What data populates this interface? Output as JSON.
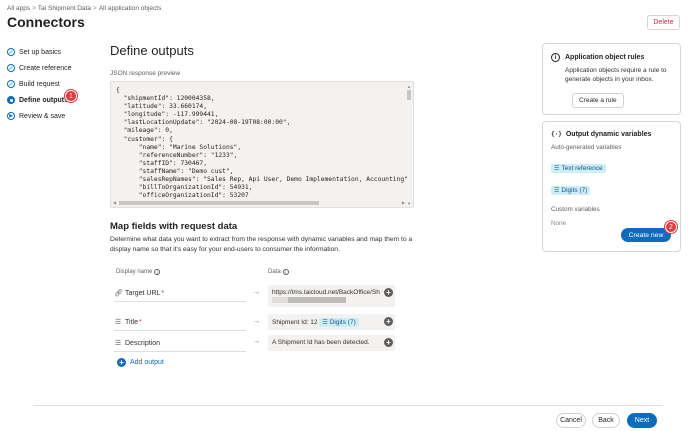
{
  "breadcrumb": [
    "All apps",
    "Tai Shipment Data",
    "All application objects"
  ],
  "page_title": "Connectors",
  "delete_label": "Delete",
  "steps": [
    {
      "label": "Set up basics",
      "state": "done"
    },
    {
      "label": "Create reference",
      "state": "done"
    },
    {
      "label": "Build request",
      "state": "done"
    },
    {
      "label": "Define outputs",
      "state": "current"
    },
    {
      "label": "Review & save",
      "state": "pending"
    }
  ],
  "annotations": {
    "step_badge": "1",
    "create_badge": "2"
  },
  "main": {
    "title": "Define outputs",
    "json_label": "JSON response preview",
    "json_lines": [
      "{",
      "  \"shipmentId\": 120004358,",
      "  \"latitude\": 33.660174,",
      "  \"longitude\": -117.999441,",
      "  \"lastLocationUpdate\": \"2024-08-19T08:00:00\",",
      "  \"mileage\": 0,",
      "  \"customer\": {",
      "      \"name\": \"Marine Solutions\",",
      "      \"referenceNumber\": \"1233\",",
      "      \"staffID\": 730467,",
      "      \"staffName\": \"Demo cust\",",
      "      \"salesRepNames\": \"Sales Rep, Api User, Demo Implementation, Accounting\"",
      "      \"billToOrganizationId\": 54931,",
      "      \"officeOrganizationId\": 53207"
    ],
    "map_title": "Map fields with request data",
    "map_desc": "Determine what data you want to extract from the response with dynamic variables and map them to a display name so that it's easy for your end-users to consumer the information.",
    "col_display": "Display name",
    "col_data": "Data",
    "rows": [
      {
        "name": "Target URL",
        "required": "*",
        "icon": "link-icon",
        "data": "https://tms.taicloud.net/BackOffice/Sh"
      },
      {
        "name": "Title",
        "required": "*",
        "icon": "text-icon",
        "data": "Shipment Id: 12",
        "chip": "Digits (7)"
      },
      {
        "name": "Description",
        "required": "",
        "icon": "text-icon",
        "data": "A Shipment Id has been detected."
      }
    ],
    "add_output": "Add output"
  },
  "app_rules": {
    "title": "Application object rules",
    "text": "Application objects require a rule to generate objects in your inbox.",
    "button": "Create a rule"
  },
  "dyn_vars": {
    "title": "Output dynamic variables",
    "auto_label": "Auto-generated variables",
    "auto_items": [
      "Text reference",
      "Digits (7)"
    ],
    "custom_label": "Custom variables",
    "custom_none": "None",
    "create_new": "Create new"
  },
  "footer": {
    "cancel": "Cancel",
    "back": "Back",
    "next": "Next"
  },
  "colors": {
    "accent": "#0f6cbd",
    "danger": "#c4314b",
    "badge": "#e03a3e",
    "chip_bg": "#cdeef6"
  }
}
